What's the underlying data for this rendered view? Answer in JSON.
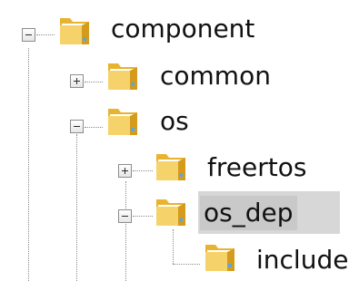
{
  "tree": {
    "nodes": [
      {
        "label": "component",
        "state": "expanded"
      },
      {
        "label": "common",
        "state": "collapsed"
      },
      {
        "label": "os",
        "state": "expanded"
      },
      {
        "label": "freertos",
        "state": "collapsed"
      },
      {
        "label": "os_dep",
        "state": "expanded",
        "selected": true
      },
      {
        "label": "include",
        "state": "leaf"
      }
    ]
  },
  "icons": {
    "folder": "folder-icon",
    "expand": "plus-icon",
    "collapse": "minus-icon"
  },
  "colors": {
    "selection": "#c9c9c9",
    "folder": "#f2c744",
    "lines": "#8a8a8a"
  }
}
